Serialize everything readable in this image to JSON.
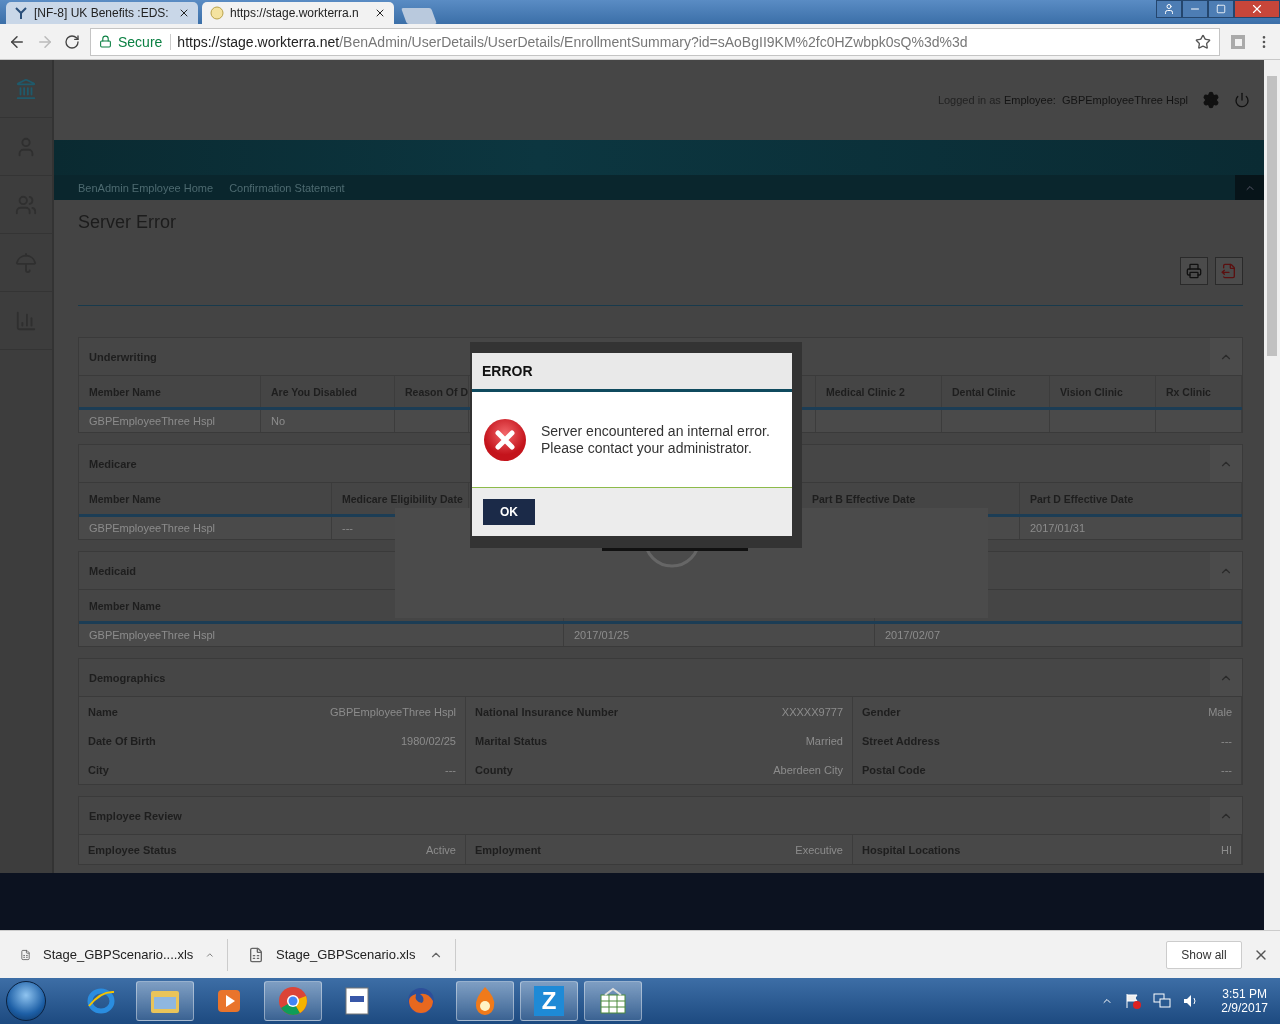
{
  "browser": {
    "tabs": [
      {
        "title": "[NF-8] UK Benefits :EDS:",
        "selected": false
      },
      {
        "title": "https://stage.workterra.n",
        "selected": true
      }
    ],
    "address": {
      "secure_label": "Secure",
      "host": "https://stage.workterra.net",
      "path": "/BenAdmin/UserDetails/UserDetails/EnrollmentSummary?id=sAoBgII9KM%2fc0HZwbpk0sQ%3d%3d"
    }
  },
  "sidebar": {
    "items": [
      {
        "kind": "home",
        "selected": true
      },
      {
        "kind": "person",
        "selected": false
      },
      {
        "kind": "people",
        "selected": false
      },
      {
        "kind": "benefits",
        "selected": false
      },
      {
        "kind": "chart",
        "selected": false
      }
    ]
  },
  "header": {
    "logged_in_label": "Logged in as",
    "role": "Employee:",
    "user": "GBPEmployeeThree Hspl"
  },
  "breadcrumbs": [
    "BenAdmin Employee Home",
    "Confirmation Statement"
  ],
  "page_title": "Server Error",
  "sections": [
    {
      "title": "Underwriting",
      "kind": "table",
      "expanded": true,
      "columns": [
        "Member Name",
        "Are You Disabled",
        "Reason Of D",
        null,
        "Medical Clinic 2",
        "Dental Clinic",
        "Vision Clinic",
        "Rx Clinic"
      ],
      "rows": [
        [
          "GBPEmployeeThree Hspl",
          "No",
          null,
          null,
          null,
          null,
          null,
          null
        ]
      ]
    },
    {
      "title": "Medicare",
      "kind": "table",
      "expanded": true,
      "columns": [
        "Member Name",
        "Medicare Eligibility Date",
        null,
        "Part B Effective Date",
        "Part D Effective Date"
      ],
      "rows": [
        [
          "GBPEmployeeThree Hspl",
          "---",
          null,
          null,
          "2017/01/31"
        ]
      ]
    },
    {
      "title": "Medicaid",
      "kind": "table",
      "expanded": true,
      "columns": [
        "Member Name",
        null,
        null
      ],
      "rows": [
        [
          "GBPEmployeeThree Hspl",
          "2017/01/25",
          "2017/02/07"
        ]
      ]
    },
    {
      "title": "Demographics",
      "kind": "fields",
      "expanded": true,
      "fields": [
        {
          "label": "Name",
          "value": "GBPEmployeeThree Hspl"
        },
        {
          "label": "National Insurance Number",
          "value": "XXXXX9777"
        },
        {
          "label": "Gender",
          "value": "Male"
        },
        {
          "label": "Date Of Birth",
          "value": "1980/02/25"
        },
        {
          "label": "Marital Status",
          "value": "Married"
        },
        {
          "label": "Street Address",
          "value": "---"
        },
        {
          "label": "City",
          "value": "---"
        },
        {
          "label": "County",
          "value": "Aberdeen City"
        },
        {
          "label": "Postal Code",
          "value": "---"
        }
      ]
    },
    {
      "title": "Employee Review",
      "kind": "fields",
      "expanded": true,
      "fields": [
        {
          "label": "Employee Status",
          "value": "Active"
        },
        {
          "label": "Employment",
          "value": "Executive"
        },
        {
          "label": "Hospital Locations",
          "value": "HI"
        }
      ]
    }
  ],
  "dialog": {
    "title": "ERROR",
    "message": [
      "Server encountered an internal error.",
      "Please contact your administrator."
    ],
    "button": "OK"
  },
  "downloads": {
    "items": [
      "Stage_GBPScenario....xls",
      "Stage_GBPScenario.xls"
    ],
    "show_all": "Show all"
  },
  "taskbar": {
    "apps": [
      {
        "kind": "ie",
        "open": false
      },
      {
        "kind": "folder",
        "open": true
      },
      {
        "kind": "media",
        "open": false
      },
      {
        "kind": "chrome",
        "open": true
      },
      {
        "kind": "document",
        "open": false
      },
      {
        "kind": "firefox",
        "open": false
      },
      {
        "kind": "flame",
        "open": true
      },
      {
        "kind": "z",
        "open": true,
        "label": "Z"
      },
      {
        "kind": "sheet",
        "open": true
      }
    ],
    "clock": {
      "time": "3:51 PM",
      "date": "2/9/2017"
    }
  }
}
